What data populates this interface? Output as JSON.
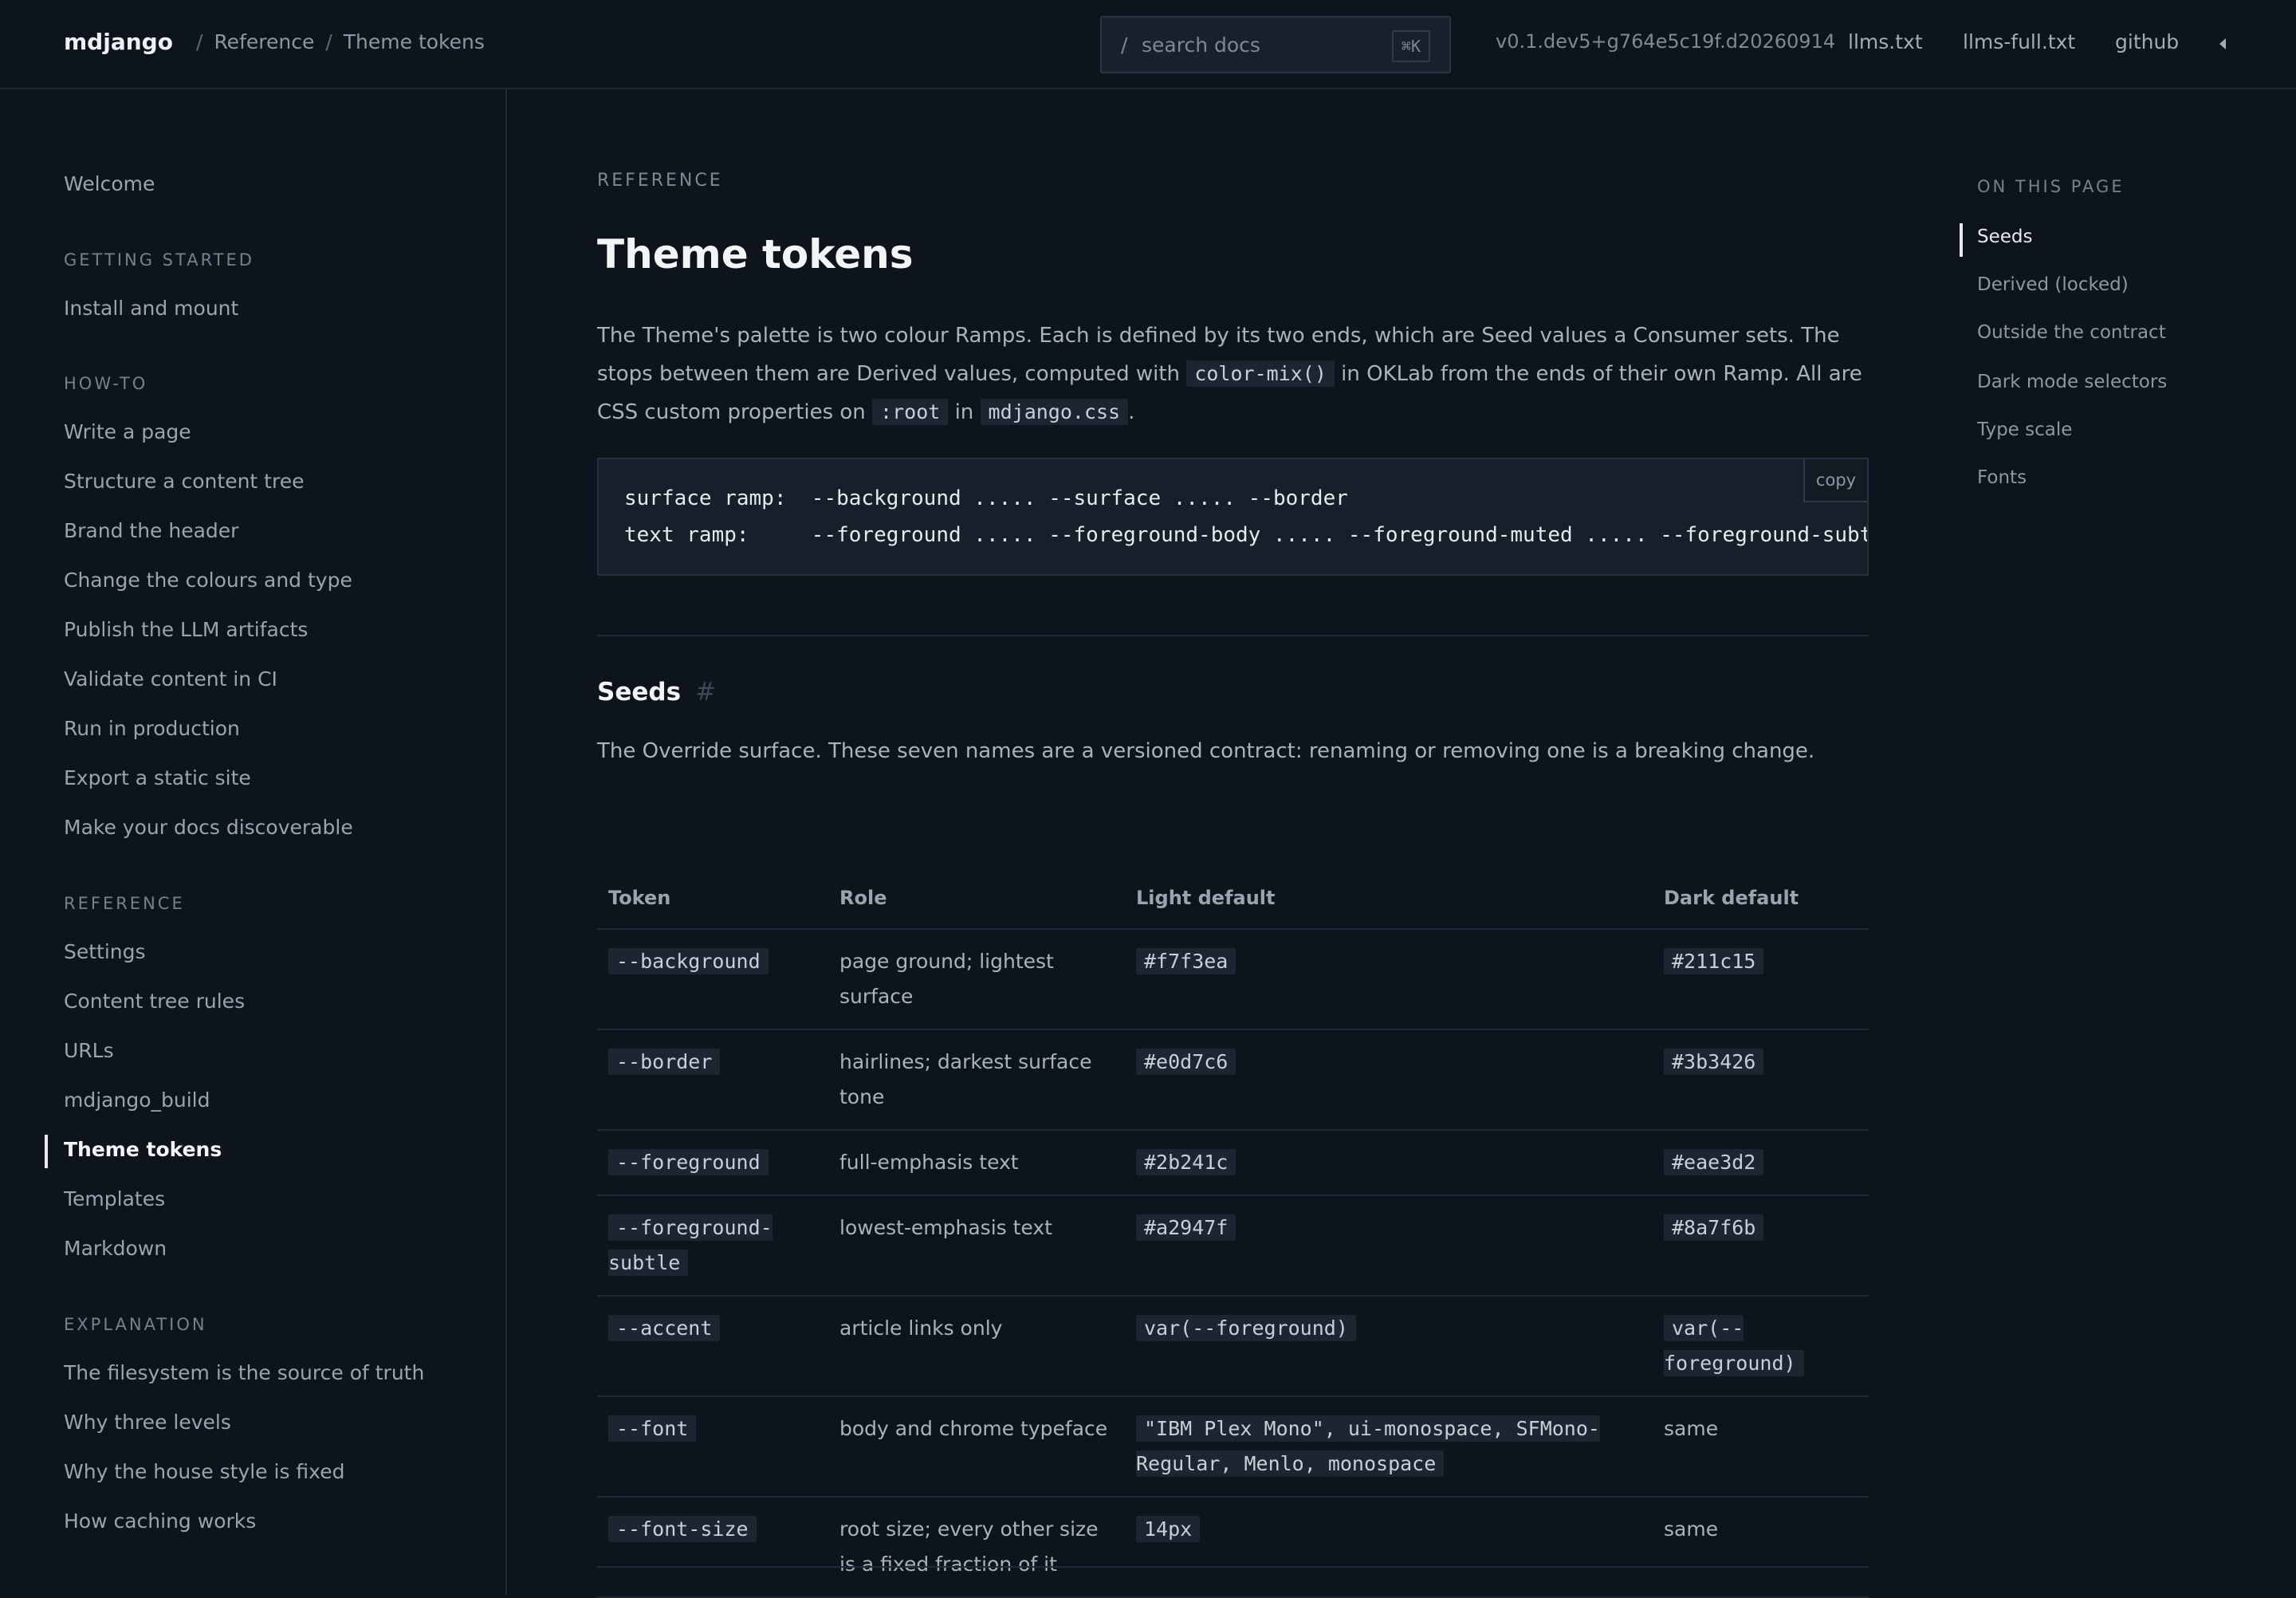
{
  "header": {
    "brand": "mdjango",
    "breadcrumb": [
      "Reference",
      "Theme tokens"
    ],
    "breadcrumb_sep": "/",
    "search": {
      "slash": "/",
      "placeholder": "search docs",
      "shortcut": "⌘K"
    },
    "version": "v0.1.dev5+g764e5c19f.d20260914",
    "links": [
      "llms.txt",
      "llms-full.txt",
      "github"
    ],
    "theme_toggle_icon": "half-moon-icon"
  },
  "sidebar": {
    "welcome": "Welcome",
    "sections": [
      {
        "title": "GETTING STARTED",
        "items": [
          "Install and mount"
        ]
      },
      {
        "title": "HOW-TO",
        "items": [
          "Write a page",
          "Structure a content tree",
          "Brand the header",
          "Change the colours and type",
          "Publish the LLM artifacts",
          "Validate content in CI",
          "Run in production",
          "Export a static site",
          "Make your docs discoverable"
        ]
      },
      {
        "title": "REFERENCE",
        "items": [
          "Settings",
          "Content tree rules",
          "URLs",
          "mdjango_build",
          "Theme tokens",
          "Templates",
          "Markdown"
        ]
      },
      {
        "title": "EXPLANATION",
        "items": [
          "The filesystem is the source of truth",
          "Why three levels",
          "Why the house style is fixed",
          "How caching works"
        ]
      }
    ],
    "active": "Theme tokens"
  },
  "main": {
    "eyebrow": "REFERENCE",
    "title": "Theme tokens",
    "intro": {
      "p1": "The Theme's palette is two colour Ramps. Each is defined by its two ends, which are Seed values a Consumer sets. The stops between them are Derived values, computed with ",
      "code1": "color-mix()",
      "p2": " in OKLab from the ends of their own Ramp. All are CSS custom properties on ",
      "code2": ":root",
      "p3": " in ",
      "code3": "mdjango.css",
      "p4": "."
    },
    "codeblock": {
      "lines": [
        "surface ramp:  --background ..... --surface ..... --border",
        "text ramp:     --foreground ..... --foreground-body ..... --foreground-muted ..... --foreground-subtle"
      ],
      "copy_label": "copy"
    },
    "seeds": {
      "heading": "Seeds",
      "anchor": "#",
      "description": "The Override surface. These seven names are a versioned contract: renaming or removing one is a breaking change.",
      "columns": [
        "Token",
        "Role",
        "Light default",
        "Dark default"
      ],
      "rows": [
        {
          "token": "--background",
          "role": "page ground; lightest surface",
          "light": "#f7f3ea",
          "dark": "#211c15"
        },
        {
          "token": "--border",
          "role": "hairlines; darkest surface tone",
          "light": "#e0d7c6",
          "dark": "#3b3426"
        },
        {
          "token": "--foreground",
          "role": "full-emphasis text",
          "light": "#2b241c",
          "dark": "#eae3d2"
        },
        {
          "token": "--foreground-subtle",
          "role": "lowest-emphasis text",
          "light": "#a2947f",
          "dark": "#8a7f6b"
        },
        {
          "token": "--accent",
          "role": "article links only",
          "light": "var(--foreground)",
          "dark": "var(--foreground)"
        },
        {
          "token": "--font",
          "role": "body and chrome typeface",
          "light": "\"IBM Plex Mono\", ui-monospace, SFMono-Regular, Menlo, monospace",
          "dark": "same"
        },
        {
          "token": "--font-size",
          "role": "root size; every other size is a fixed fraction of it",
          "light": "14px",
          "dark": "same"
        }
      ]
    }
  },
  "toc": {
    "heading": "ON THIS PAGE",
    "entries": [
      "Seeds",
      "Derived (locked)",
      "Outside the contract",
      "Dark mode selectors",
      "Type scale",
      "Fonts"
    ],
    "current": "Seeds"
  },
  "colors": {
    "background": "#0d141c",
    "border": "#1e2a36",
    "text": "#a9b2bd",
    "heading": "#f2f4f6",
    "code_bg": "#1b2632"
  }
}
